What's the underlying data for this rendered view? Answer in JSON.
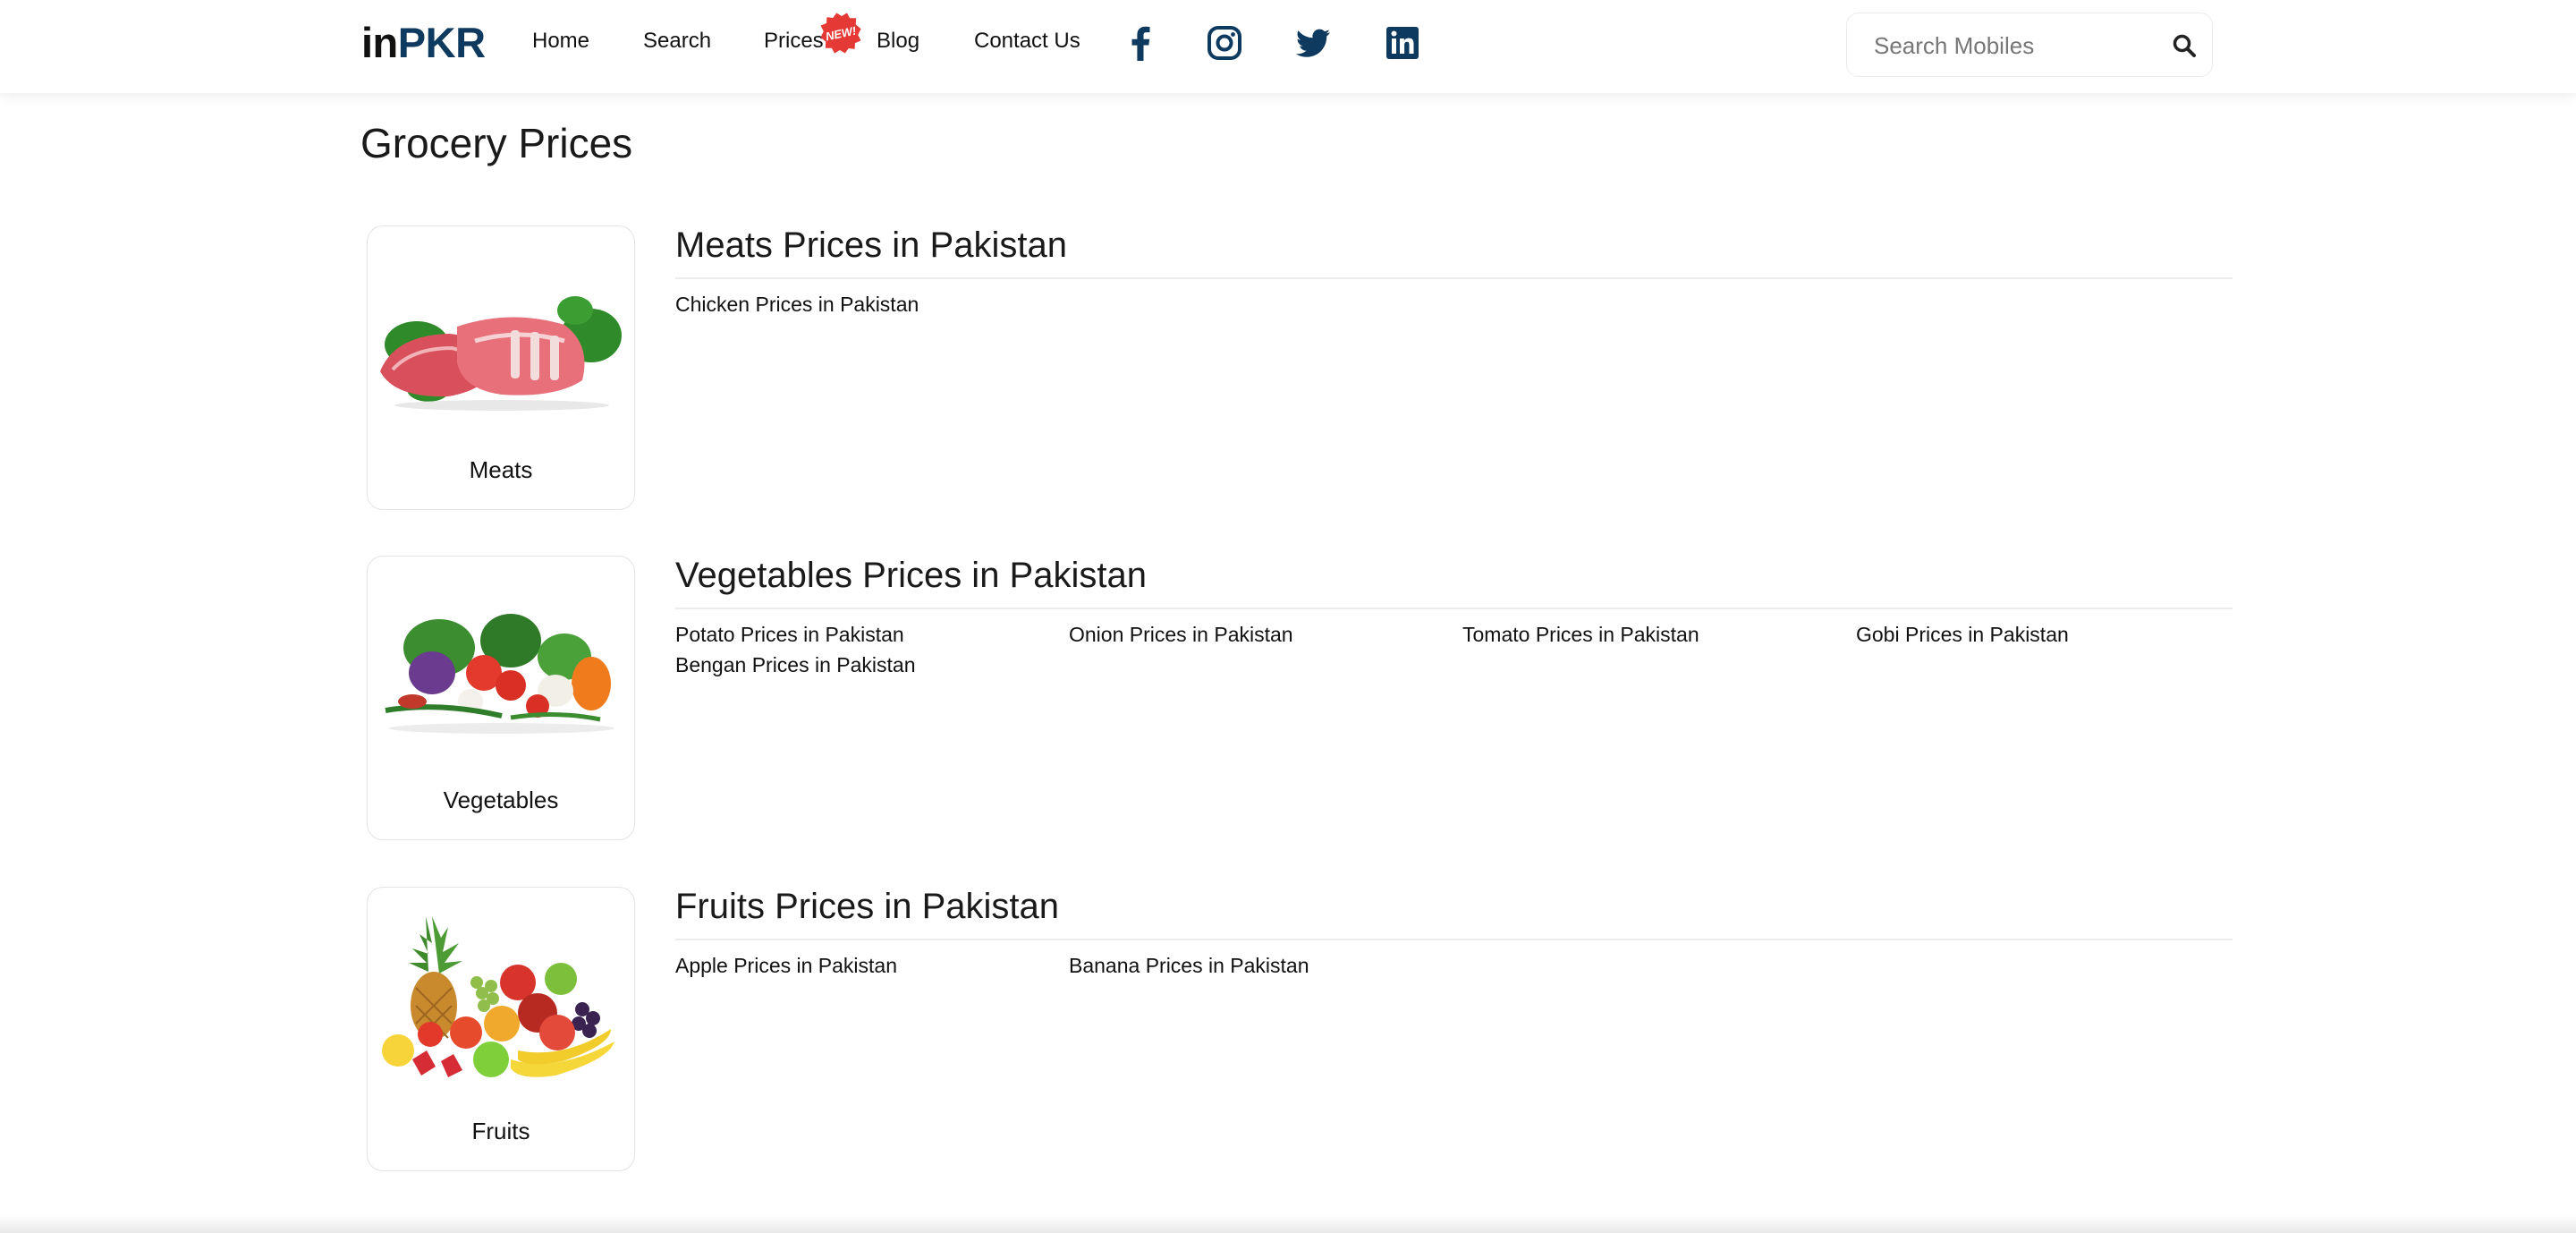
{
  "brand": {
    "prefix": "in",
    "suffix": "PKR"
  },
  "nav": {
    "home": "Home",
    "search": "Search",
    "prices": "Prices",
    "new_badge": "NEW!",
    "blog": "Blog",
    "contact": "Contact Us"
  },
  "social_icons": [
    "facebook-icon",
    "instagram-icon",
    "twitter-icon",
    "linkedin-icon"
  ],
  "search": {
    "placeholder": "Search Mobiles"
  },
  "colors": {
    "brand": "#0e3a5f",
    "badge": "#e53935"
  },
  "page_title": "Grocery Prices",
  "categories": [
    {
      "name": "Meats",
      "title": "Meats Prices in Pakistan",
      "links": [
        "Chicken Prices in Pakistan"
      ]
    },
    {
      "name": "Vegetables",
      "title": "Vegetables Prices in Pakistan",
      "links": [
        "Potato Prices in Pakistan",
        "Onion Prices in Pakistan",
        "Tomato Prices in Pakistan",
        "Gobi Prices in Pakistan",
        "Bengan Prices in Pakistan"
      ]
    },
    {
      "name": "Fruits",
      "title": "Fruits Prices in Pakistan",
      "links": [
        "Apple Prices in Pakistan",
        "Banana Prices in Pakistan"
      ]
    }
  ]
}
